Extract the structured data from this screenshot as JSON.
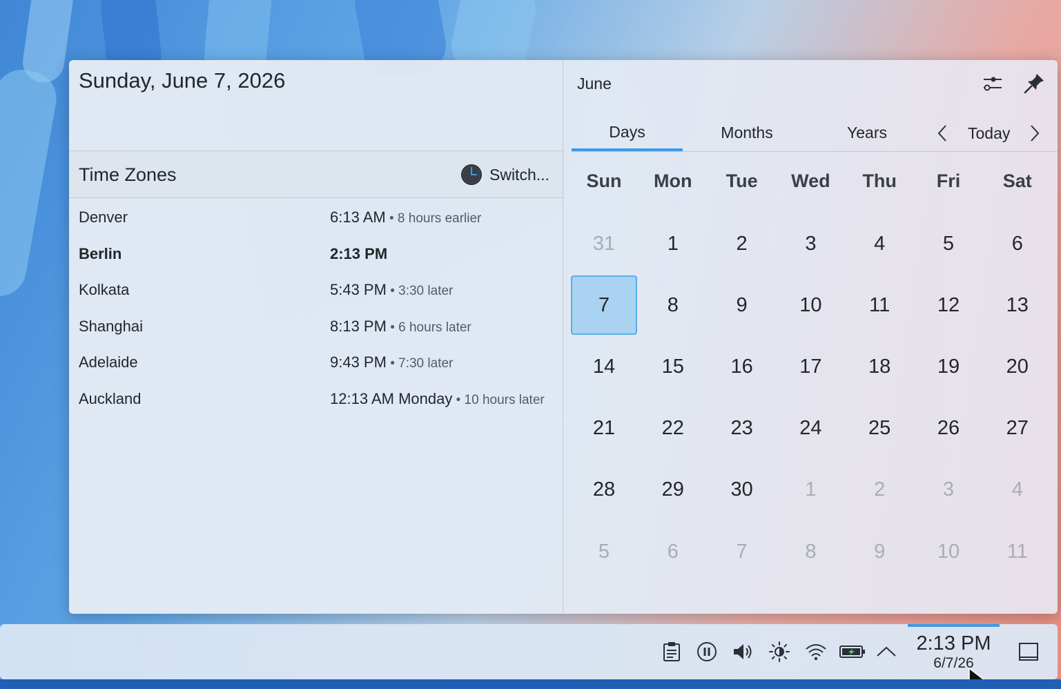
{
  "header": {
    "date_title": "Sunday, June 7, 2026"
  },
  "timezones": {
    "title": "Time Zones",
    "switch_label": "Switch...",
    "rows": [
      {
        "city": "Denver",
        "time": "6:13 AM",
        "diff": " • 8 hours earlier",
        "current": false
      },
      {
        "city": "Berlin",
        "time": "2:13 PM",
        "diff": "",
        "current": true
      },
      {
        "city": "Kolkata",
        "time": "5:43 PM",
        "diff": " • 3:30 later",
        "current": false
      },
      {
        "city": "Shanghai",
        "time": "8:13 PM",
        "diff": " • 6 hours later",
        "current": false
      },
      {
        "city": "Adelaide",
        "time": "9:43 PM",
        "diff": " • 7:30 later",
        "current": false
      },
      {
        "city": "Auckland",
        "time": "12:13 AM Monday",
        "diff": " • 10 hours later",
        "current": false
      }
    ]
  },
  "calendar": {
    "month": "June",
    "tabs": [
      "Days",
      "Months",
      "Years"
    ],
    "active_tab": "Days",
    "today_label": "Today",
    "weekdays": [
      "Sun",
      "Mon",
      "Tue",
      "Wed",
      "Thu",
      "Fri",
      "Sat"
    ],
    "weeks": [
      [
        {
          "d": "31",
          "o": true
        },
        {
          "d": "1"
        },
        {
          "d": "2"
        },
        {
          "d": "3"
        },
        {
          "d": "4"
        },
        {
          "d": "5"
        },
        {
          "d": "6"
        }
      ],
      [
        {
          "d": "7",
          "t": true
        },
        {
          "d": "8"
        },
        {
          "d": "9"
        },
        {
          "d": "10"
        },
        {
          "d": "11"
        },
        {
          "d": "12"
        },
        {
          "d": "13"
        }
      ],
      [
        {
          "d": "14"
        },
        {
          "d": "15"
        },
        {
          "d": "16"
        },
        {
          "d": "17"
        },
        {
          "d": "18"
        },
        {
          "d": "19"
        },
        {
          "d": "20"
        }
      ],
      [
        {
          "d": "21"
        },
        {
          "d": "22"
        },
        {
          "d": "23"
        },
        {
          "d": "24"
        },
        {
          "d": "25"
        },
        {
          "d": "26"
        },
        {
          "d": "27"
        }
      ],
      [
        {
          "d": "28"
        },
        {
          "d": "29"
        },
        {
          "d": "30"
        },
        {
          "d": "1",
          "o": true
        },
        {
          "d": "2",
          "o": true
        },
        {
          "d": "3",
          "o": true
        },
        {
          "d": "4",
          "o": true
        }
      ],
      [
        {
          "d": "5",
          "o": true
        },
        {
          "d": "6",
          "o": true
        },
        {
          "d": "7",
          "o": true
        },
        {
          "d": "8",
          "o": true
        },
        {
          "d": "9",
          "o": true
        },
        {
          "d": "10",
          "o": true
        },
        {
          "d": "11",
          "o": true
        }
      ]
    ]
  },
  "taskbar": {
    "tray_icons": [
      "clipboard-icon",
      "media-pause-icon",
      "volume-icon",
      "brightness-icon",
      "wifi-icon",
      "battery-icon",
      "expand-tray-icon"
    ],
    "clock_time": "2:13 PM",
    "clock_date": "6/7/26",
    "accent": "#3d9ae8"
  }
}
